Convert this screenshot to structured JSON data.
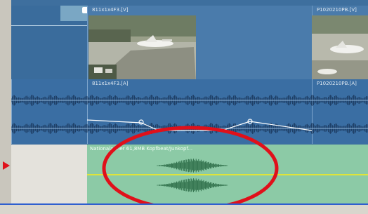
{
  "video_track": {
    "clip1_label": "811x1x4F3.[V]",
    "clip2_label": "P1020210PB.[V]"
  },
  "audio_track": {
    "clip1_label": "811x1x4F3.[A]",
    "clip2_label": "P1020210PB.[A]"
  },
  "music_track": {
    "clip_label": "Nationaladher 61,8MB Kopfbeat/Junkopf..."
  },
  "colors": {
    "accent": "#2f5fcf",
    "annotation": "#e0101a",
    "volume_line": "#dfe43a"
  }
}
